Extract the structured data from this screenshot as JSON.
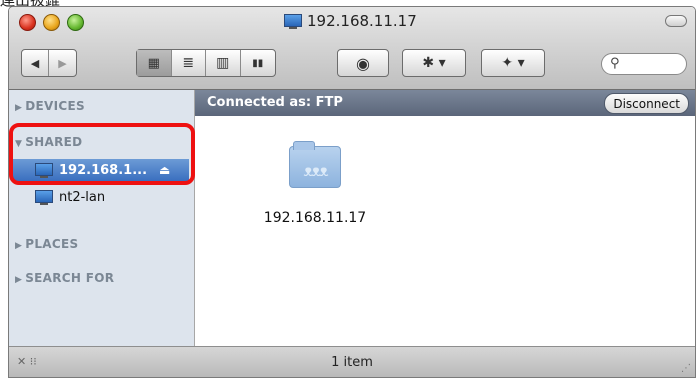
{
  "caption": "連出扱錐",
  "window": {
    "title": "192.168.11.17"
  },
  "toolbar": {
    "back_glyph": "◀",
    "forward_glyph": "▶",
    "view_icon_glyph": "▦",
    "view_list_glyph": "≣",
    "view_column_glyph": "▥",
    "view_coverflow_glyph": "▮▮",
    "quicklook_glyph": "◉",
    "action_glyph": "✱ ▾",
    "dropbox_glyph": "✦ ▾",
    "search_glyph": "⚲"
  },
  "sidebar": {
    "devices_label": "DEVICES",
    "shared_label": "SHARED",
    "places_label": "PLACES",
    "search_label": "SEARCH FOR",
    "collapsed_tri": "▶",
    "expanded_tri": "▼",
    "items": [
      {
        "label": "192.168.1...",
        "selected": true,
        "eject": "⏏"
      },
      {
        "label": "nt2-lan",
        "selected": false
      }
    ]
  },
  "pathbar": {
    "text": "Connected as: FTP",
    "disconnect_label": "Disconnect"
  },
  "content": {
    "items": [
      {
        "label": "192.168.11.17",
        "icon": "network-folder-icon"
      }
    ]
  },
  "statusbar": {
    "text": "1 item",
    "left_glyph": "✕ ⁝⁝"
  },
  "colors": {
    "selection": "#3a6fbf",
    "highlight_outline": "#e11111",
    "sidebar_bg": "#dde4ed"
  }
}
